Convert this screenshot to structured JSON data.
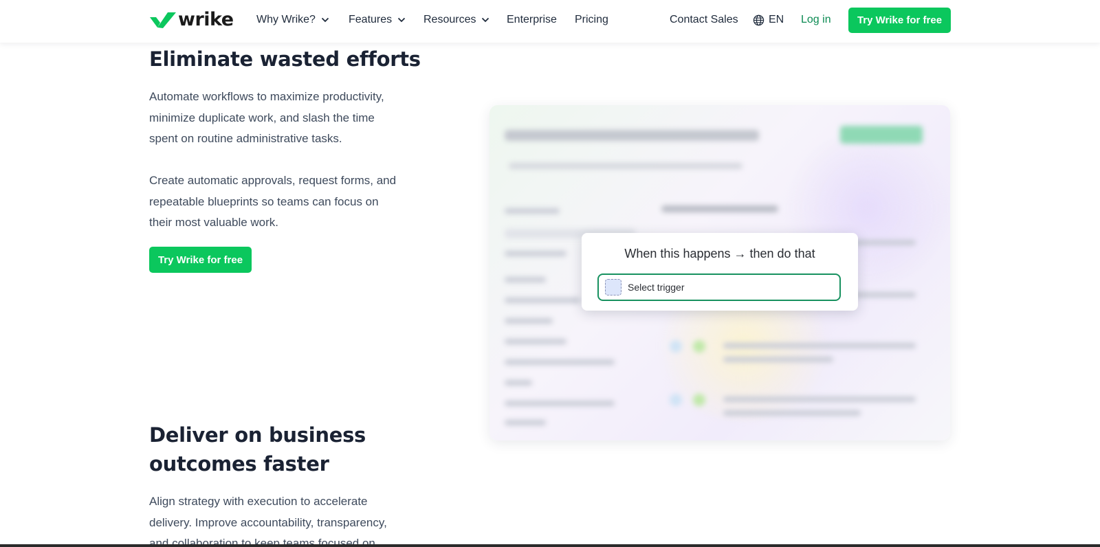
{
  "header": {
    "brand": "wrike",
    "nav": [
      {
        "label": "Why Wrike?",
        "has_dropdown": true
      },
      {
        "label": "Features",
        "has_dropdown": true
      },
      {
        "label": "Resources",
        "has_dropdown": true
      },
      {
        "label": "Enterprise",
        "has_dropdown": false
      },
      {
        "label": "Pricing",
        "has_dropdown": false
      }
    ],
    "contact_sales": "Contact Sales",
    "language": "EN",
    "login": "Log in",
    "cta": "Try Wrike for free"
  },
  "section1": {
    "title": "Eliminate wasted efforts",
    "paragraph1": "Automate workflows to maximize productivity, minimize duplicate work, and slash the time spent on routine administrative tasks.",
    "paragraph2": "Create automatic approvals, request forms, and repeatable blueprints so teams can focus on their most valuable work.",
    "cta": "Try Wrike for free"
  },
  "illustration": {
    "popup_title": "When this happens → then do that",
    "trigger_label": "Select trigger"
  },
  "section2": {
    "title": "Deliver on business outcomes faster",
    "paragraph": "Align strategy with execution to accelerate delivery. Improve accountability, transparency, and collaboration to keep teams focused on"
  },
  "colors": {
    "brand_green": "#0bc75d",
    "link_green": "#0b8a52",
    "trigger_border": "#17915f",
    "heading": "#1a2233",
    "body_text": "#3e4a5c"
  }
}
